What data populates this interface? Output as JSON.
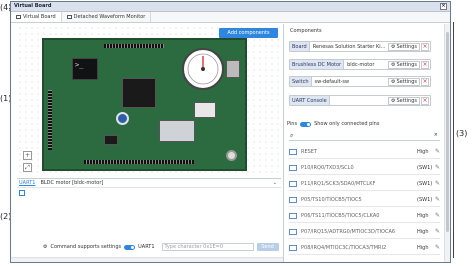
{
  "callouts": {
    "c4": "(4)",
    "c1": "(1)",
    "c2": "(2)",
    "c3": "(3)"
  },
  "window": {
    "title": "Virtual Board",
    "close": "×"
  },
  "tabs": [
    {
      "label": "Virtual Board"
    },
    {
      "label": "Detached Waveform Monitor"
    }
  ],
  "canvas": {
    "add_button": "Add components",
    "lcd_prompt": ">_",
    "zoom_in": "+",
    "zoom_fit": "⤢"
  },
  "console": {
    "tab_label": "UART1",
    "device": "BLDC motor [bldc-motor]",
    "chevron": "⌄",
    "gear": "⚙",
    "cmd_support_label": "Command supports settings",
    "toggle_label": "UART1",
    "input_placeholder": "Type character 0x1E=0",
    "send_label": "Send"
  },
  "side": {
    "components_title": "Components",
    "components": [
      {
        "type": "Board",
        "name": "Renesas Solution Starter Ki..."
      },
      {
        "type": "Brushless DC Motor",
        "name": "bldc-motor"
      },
      {
        "type": "Switch",
        "name": "sw-default-sw"
      },
      {
        "type": "UART Console",
        "name": ""
      }
    ],
    "settings_label": "Settings",
    "remove": "×",
    "pins_title": "Pins",
    "pins_toggle_label": "Show only connected pins",
    "search_icon": "⌕",
    "search_clear": "×",
    "pins": [
      {
        "name": "RESET",
        "value": "High"
      },
      {
        "name": "P10/IRQ0/TXD3/SCL0",
        "value": "(SW1)"
      },
      {
        "name": "P11/IRQ1/SCK3/SDA0/MTCLKF",
        "value": "(SW1)"
      },
      {
        "name": "P05/TS10/TIOCB5/TIOC5",
        "value": "(SW1)"
      },
      {
        "name": "P06/TS11/TIOCB5/TIOC5/CLKA0",
        "value": "High"
      },
      {
        "name": "P07/IRQ15/ADTRG0/MTIOC3D/TIOCA6",
        "value": "High"
      },
      {
        "name": "P08/IRQ4/MTIOC3C/TIOCA3/TMRI2",
        "value": "High"
      }
    ],
    "pin_edit": "✎"
  }
}
